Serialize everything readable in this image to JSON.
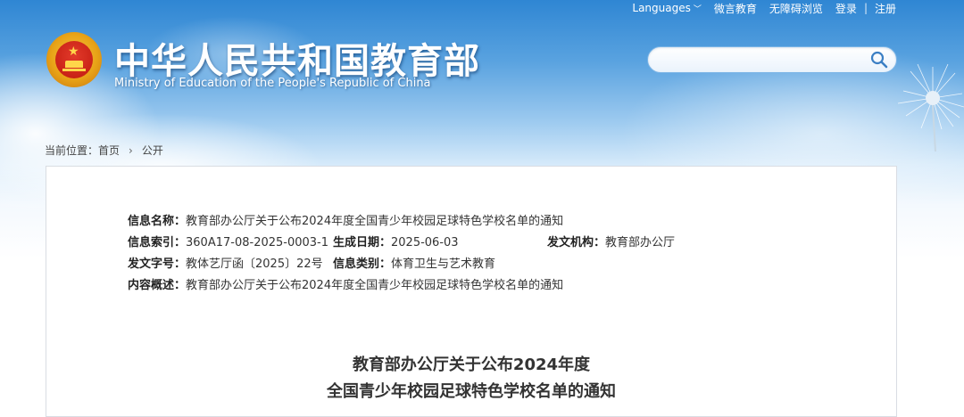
{
  "header": {
    "links": {
      "languages": "Languages",
      "weibo": "微言教育",
      "accessibility": "无障碍浏览",
      "login": "登录",
      "separator": "|",
      "register": "注册"
    },
    "site_title": "中华人民共和国教育部",
    "site_subtitle": "Ministry of Education of the People's Republic of China",
    "search": {
      "value": ""
    }
  },
  "breadcrumb": {
    "prefix": "当前位置：",
    "home": "首页",
    "arrow": "›",
    "current": "公开"
  },
  "meta": {
    "name_label": "信息名称：",
    "name_value": "教育部办公厅关于公布2024年度全国青少年校园足球特色学校名单的通知",
    "index_label": "信息索引：",
    "index_value": "360A17-08-2025-0003-1",
    "date_label": "生成日期：",
    "date_value": "2025-06-03",
    "org_label": "发文机构：",
    "org_value": "教育部办公厅",
    "docno_label": "发文字号：",
    "docno_value": "教体艺厅函〔2025〕22号",
    "category_label": "信息类别：",
    "category_value": "体育卫生与艺术教育",
    "summary_label": "内容概述：",
    "summary_value": "教育部办公厅关于公布2024年度全国青少年校园足球特色学校名单的通知"
  },
  "document": {
    "title_line1": "教育部办公厅关于公布2024年度",
    "title_line2": "全国青少年校园足球特色学校名单的通知"
  },
  "colors": {
    "sky_top": "#2f86d3",
    "title_text": "#ffffff",
    "border": "#d9dde3"
  },
  "icons": [
    "national-emblem-icon",
    "search-icon",
    "chevron-down-icon",
    "dandelion-decoration"
  ]
}
